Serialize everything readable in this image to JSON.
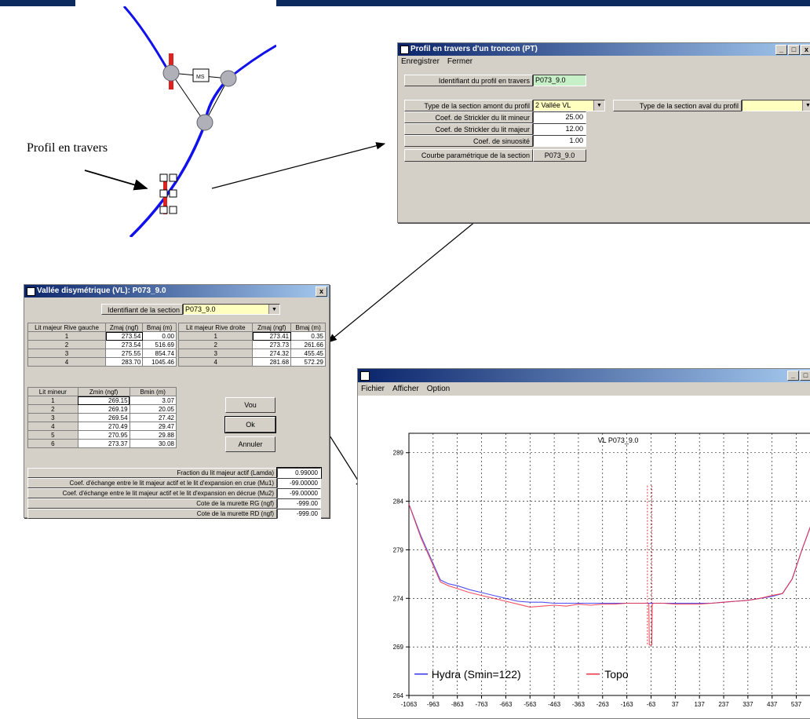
{
  "annotation": {
    "profil_label": "Profil en travers"
  },
  "network": {
    "node_label": "MS"
  },
  "pt_window": {
    "title": "Profil en travers d'un troncon (PT)",
    "menu": [
      "Enregistrer",
      "Fermer"
    ],
    "id_label": "Identifiant du profil en travers",
    "id_value": "P073_9.0",
    "amont_label": "Type de la section amont du profil",
    "amont_value": "2 Vallée VL",
    "aval_label": "Type de la section aval du profil",
    "aval_value": "",
    "strickler_mineur_label": "Coef. de Strickler du lit mineur",
    "strickler_mineur_value": "25.00",
    "strickler_majeur_label": "Coef. de Strickler du lit majeur",
    "strickler_majeur_value": "12.00",
    "sinuosite_label": "Coef. de sinuosité",
    "sinuosite_value": "1.00",
    "courbe_label": "Courbe paramétrique de la section",
    "courbe_value": "P073_9.0"
  },
  "vl_window": {
    "title": "Vallée disymétrique (VL): P073_9.0",
    "close": "x",
    "id_label": "Identifiant de la section",
    "id_value": "P073_9.0",
    "left_table": {
      "headers": [
        "Lit majeur Rive gauche",
        "Zmaj (ngf)",
        "Bmaj (m)"
      ],
      "rows": [
        [
          "1",
          "273.54",
          "0.00"
        ],
        [
          "2",
          "273.54",
          "516.69"
        ],
        [
          "3",
          "275.55",
          "854.74"
        ],
        [
          "4",
          "283.70",
          "1045.46"
        ]
      ]
    },
    "right_table": {
      "headers": [
        "Lit majeur Rive droite",
        "Zmaj (ngf)",
        "Bmaj (m)"
      ],
      "rows": [
        [
          "1",
          "273.41",
          "0.35"
        ],
        [
          "2",
          "273.73",
          "261.66"
        ],
        [
          "3",
          "274.32",
          "455.45"
        ],
        [
          "4",
          "281.68",
          "572.29"
        ]
      ]
    },
    "minor_table": {
      "headers": [
        "Lit mineur",
        "Zmin (ngf)",
        "Bmin (m)"
      ],
      "rows": [
        [
          "1",
          "269.15",
          "3.07"
        ],
        [
          "2",
          "269.19",
          "20.05"
        ],
        [
          "3",
          "269.54",
          "27.42"
        ],
        [
          "4",
          "270.49",
          "29.47"
        ],
        [
          "5",
          "270.95",
          "29.88"
        ],
        [
          "6",
          "273.37",
          "30.08"
        ]
      ]
    },
    "buttons": {
      "vou": "Vou",
      "ok": "Ok",
      "annuler": "Annuler"
    },
    "params": [
      {
        "label": "Fraction du lit majeur actif (Lamda)",
        "value": "0.99000"
      },
      {
        "label": "Coef. d'échange entre le lit majeur actif et le lit d'expansion en crue (Mu1)",
        "value": "-99.00000"
      },
      {
        "label": "Coef. d'échange entre le lit majeur actif et le lit d'expansion en décrue (Mu2)",
        "value": "-99.00000"
      },
      {
        "label": "Cote de la murette RG (ngf)",
        "value": "-999.00"
      },
      {
        "label": "Cote de la murette RD (ngf)",
        "value": "-999.00"
      }
    ]
  },
  "chart_window": {
    "menu": [
      "Fichier",
      "Afficher",
      "Option"
    ]
  },
  "colors": {
    "hydra": "#3333ee",
    "topo": "#ee3344",
    "title_blue": "#0a246a",
    "top_band": "#0d2a5e"
  },
  "chart_data": {
    "type": "line",
    "title": "VL P073_9.0",
    "xlabel": "",
    "ylabel": "",
    "x_ticks": [
      "-1063",
      "-963",
      "-863",
      "-763",
      "-663",
      "-563",
      "-463",
      "-363",
      "-263",
      "-163",
      "-63",
      "37",
      "137",
      "237",
      "337",
      "437",
      "537"
    ],
    "y_ticks": [
      "264",
      "269",
      "274",
      "279",
      "284",
      "289"
    ],
    "xlim": [
      -1063,
      600
    ],
    "ylim": [
      264,
      291
    ],
    "grid": true,
    "legend": "bottom",
    "series": [
      {
        "name": "Hydra (Smin=122)",
        "x": [
          -1063,
          -1013,
          -963,
          -933,
          -900,
          -863,
          -813,
          -763,
          -713,
          -663,
          -613,
          -563,
          -513,
          -463,
          -413,
          -363,
          -313,
          -263,
          -213,
          -163,
          -113,
          -63,
          -13,
          37,
          87,
          137,
          187,
          237,
          287,
          337,
          387,
          437,
          480,
          520,
          560,
          600
        ],
        "y": [
          283.7,
          280.4,
          277.6,
          275.9,
          275.5,
          275.3,
          274.9,
          274.6,
          274.3,
          274.0,
          273.7,
          273.6,
          273.6,
          273.5,
          273.5,
          273.5,
          273.5,
          273.5,
          273.5,
          273.5,
          273.5,
          273.5,
          273.5,
          273.5,
          273.5,
          273.5,
          273.5,
          273.6,
          273.7,
          273.8,
          274.0,
          274.2,
          274.5,
          276.0,
          279.0,
          281.7
        ]
      },
      {
        "name": "Topo",
        "x": [
          -1063,
          -1013,
          -963,
          -933,
          -900,
          -863,
          -813,
          -763,
          -713,
          -663,
          -613,
          -563,
          -513,
          -463,
          -413,
          -363,
          -313,
          -263,
          -213,
          -163,
          -113,
          -78,
          -72,
          -70,
          -66,
          -60,
          -58,
          -53,
          -13,
          37,
          87,
          137,
          187,
          237,
          287,
          337,
          387,
          437,
          480,
          520,
          560,
          600
        ],
        "y": [
          283.7,
          280.2,
          277.4,
          275.7,
          275.3,
          275.0,
          274.6,
          274.3,
          274.0,
          273.7,
          273.4,
          273.1,
          273.2,
          273.3,
          273.2,
          273.4,
          273.3,
          273.4,
          273.4,
          273.5,
          273.5,
          273.5,
          273.4,
          269.2,
          269.2,
          269.2,
          273.4,
          273.5,
          273.5,
          273.4,
          273.4,
          273.4,
          273.5,
          273.6,
          273.7,
          273.8,
          274.0,
          274.3,
          274.5,
          276.0,
          279.0,
          281.7
        ]
      }
    ]
  }
}
